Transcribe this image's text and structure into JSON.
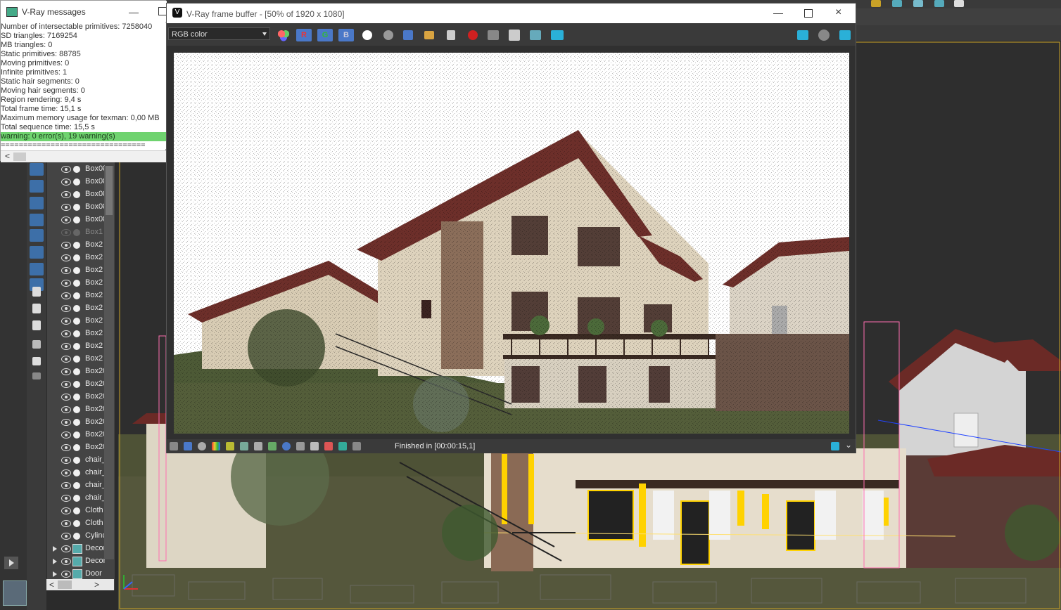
{
  "messages_window": {
    "title": "V-Ray messages",
    "lines": [
      "Number of intersectable primitives: 7258040",
      "  SD triangles: 7169254",
      "  MB triangles: 0",
      "  Static primitives: 88785",
      "  Moving primitives: 0",
      "  Infinite primitives: 1",
      "  Static hair segments: 0",
      "  Moving hair segments: 0",
      "Region rendering: 9,4 s",
      "Total frame time: 15,1 s",
      "Maximum memory usage for texman: 0,00 MB",
      "Total sequence time: 15,5 s"
    ],
    "warning": "warning: 0 error(s), 19 warning(s)",
    "separator": "================================"
  },
  "vfb": {
    "title": "V-Ray frame buffer - [50% of 1920 x 1080]",
    "channel_select": "RGB color",
    "channel_buttons": [
      "R",
      "G",
      "B"
    ],
    "status": "Finished in [00:00:15,1]",
    "colors": {
      "channel_blue": "#4a78c8",
      "stop_red": "#d02020",
      "accent_cyan": "#2ab0d8"
    }
  },
  "explorer": {
    "rows": [
      {
        "label": "Box08",
        "dim": false
      },
      {
        "label": "Box08",
        "dim": false
      },
      {
        "label": "Box08",
        "dim": false
      },
      {
        "label": "Box08",
        "dim": false
      },
      {
        "label": "Box08",
        "dim": false
      },
      {
        "label": "Box1",
        "dim": true
      },
      {
        "label": "Box2",
        "dim": false
      },
      {
        "label": "Box2",
        "dim": false
      },
      {
        "label": "Box2",
        "dim": false
      },
      {
        "label": "Box2",
        "dim": false
      },
      {
        "label": "Box2",
        "dim": false
      },
      {
        "label": "Box2",
        "dim": false
      },
      {
        "label": "Box2",
        "dim": false
      },
      {
        "label": "Box2",
        "dim": false
      },
      {
        "label": "Box2",
        "dim": false
      },
      {
        "label": "Box2",
        "dim": false
      },
      {
        "label": "Box20",
        "dim": false
      },
      {
        "label": "Box20",
        "dim": false
      },
      {
        "label": "Box20",
        "dim": false
      },
      {
        "label": "Box20",
        "dim": false
      },
      {
        "label": "Box20",
        "dim": false
      },
      {
        "label": "Box20",
        "dim": false
      },
      {
        "label": "Box20",
        "dim": false
      },
      {
        "label": "chair_",
        "dim": false
      },
      {
        "label": "chair_",
        "dim": false
      },
      {
        "label": "chair_",
        "dim": false
      },
      {
        "label": "chair_",
        "dim": false
      },
      {
        "label": "Cloth",
        "dim": false
      },
      {
        "label": "Cloth",
        "dim": false
      },
      {
        "label": "Cylinc",
        "dim": false
      },
      {
        "label": "Decor",
        "dim": false,
        "group": true
      },
      {
        "label": "Decor",
        "dim": false,
        "group": true
      },
      {
        "label": "Door",
        "dim": false,
        "group": true
      }
    ]
  }
}
